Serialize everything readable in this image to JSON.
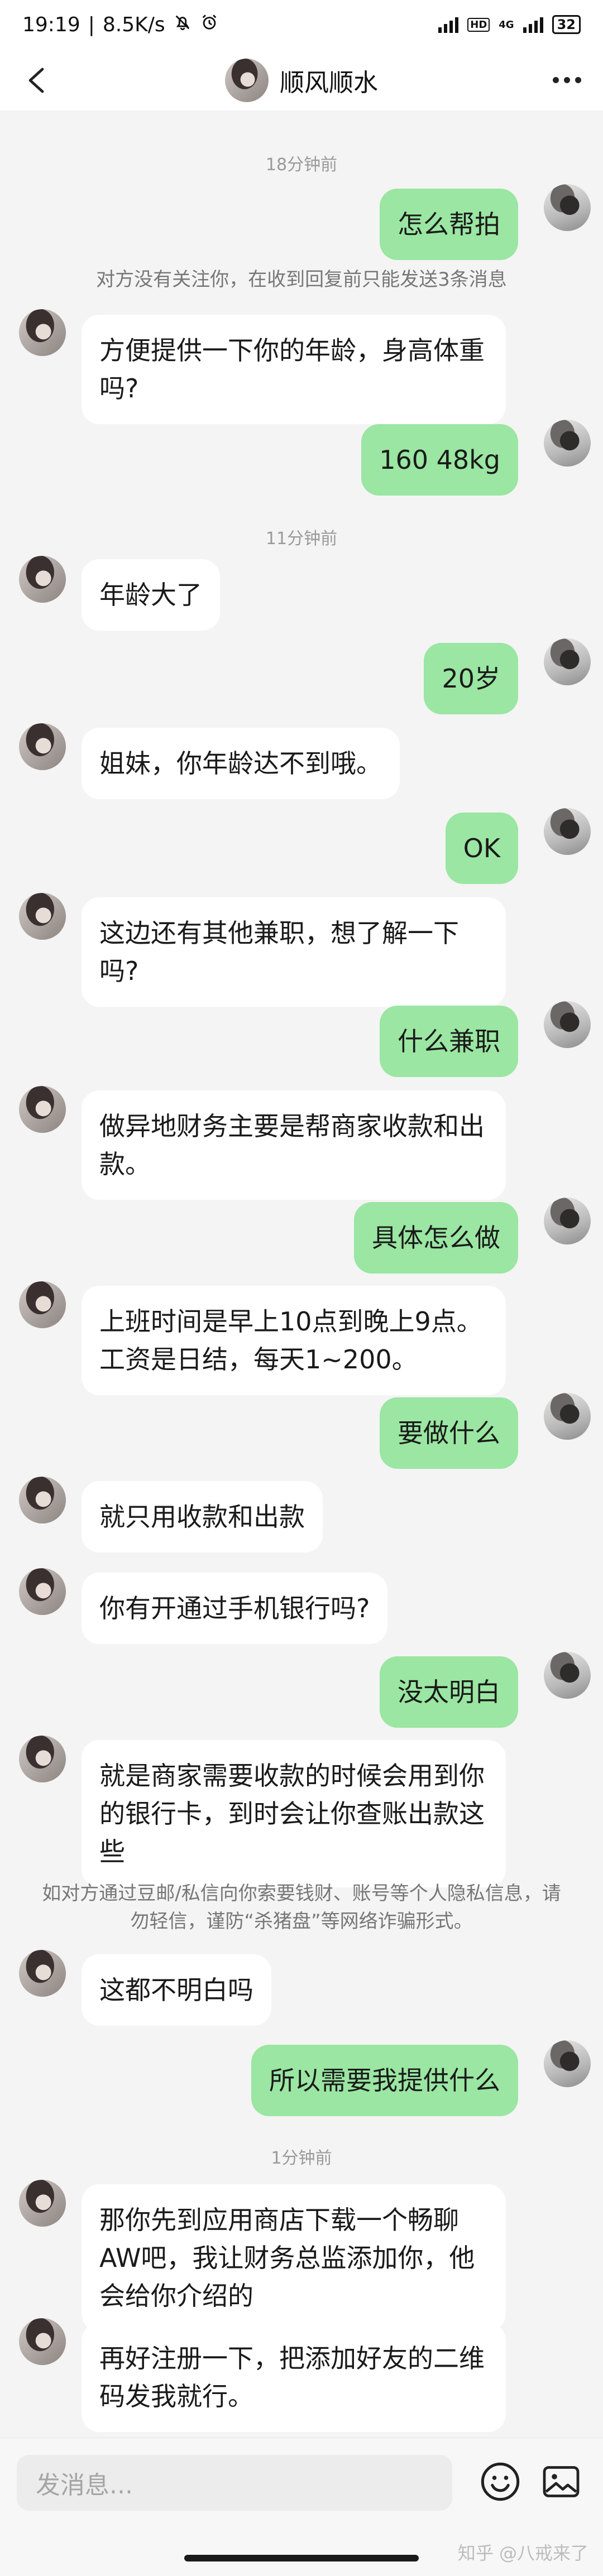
{
  "status_bar": {
    "time": "19:19",
    "speed": "8.5K/s",
    "network": "4G",
    "hd": "HD",
    "battery": "32"
  },
  "header": {
    "title": "顺风顺水"
  },
  "timestamps": [
    "18分钟前",
    "11分钟前",
    "1分钟前"
  ],
  "notices": [
    "对方没有关注你，在收到回复前只能发送3条消息",
    "如对方通过豆邮/私信向你索要钱财、账号等个人隐私信息，请勿轻信，谨防“杀猪盘”等网络诈骗形式。"
  ],
  "messages": [
    {
      "from": "me",
      "text": "怎么帮拍"
    },
    {
      "from": "other",
      "text": "方便提供一下你的年龄，身高体重吗?"
    },
    {
      "from": "me",
      "text": "160  48kg"
    },
    {
      "from": "other",
      "text": "年龄大了"
    },
    {
      "from": "me",
      "text": "20岁"
    },
    {
      "from": "other",
      "text": "姐妹，你年龄达不到哦。"
    },
    {
      "from": "me",
      "text": "OK"
    },
    {
      "from": "other",
      "text": "这边还有其他兼职，想了解一下吗?"
    },
    {
      "from": "me",
      "text": "什么兼职"
    },
    {
      "from": "other",
      "text": "做异地财务主要是帮商家收款和出款。"
    },
    {
      "from": "me",
      "text": "具体怎么做"
    },
    {
      "from": "other",
      "text": "上班时间是早上10点到晚上9点。工资是日结，每天1~200。"
    },
    {
      "from": "me",
      "text": "要做什么"
    },
    {
      "from": "other",
      "text": "就只用收款和出款"
    },
    {
      "from": "other",
      "text": "你有开通过手机银行吗?"
    },
    {
      "from": "me",
      "text": "没太明白"
    },
    {
      "from": "other",
      "text": "就是商家需要收款的时候会用到你的银行卡，到时会让你查账出款这些"
    },
    {
      "from": "other",
      "text": "这都不明白吗"
    },
    {
      "from": "me",
      "text": "所以需要我提供什么"
    },
    {
      "from": "other",
      "text": "那你先到应用商店下载一个畅聊AW吧，我让财务总监添加你，他会给你介绍的"
    },
    {
      "from": "other",
      "text": "再好注册一下，把添加好友的二维码发我就行。"
    }
  ],
  "input": {
    "placeholder": "发消息..."
  },
  "watermark": "知乎 @八戒来了",
  "icons": {
    "back": "back-arrow-icon",
    "more": "more-dots-icon",
    "emoji": "emoji-icon",
    "image": "image-icon",
    "mute": "bell-mute-icon",
    "alarm": "alarm-icon"
  }
}
